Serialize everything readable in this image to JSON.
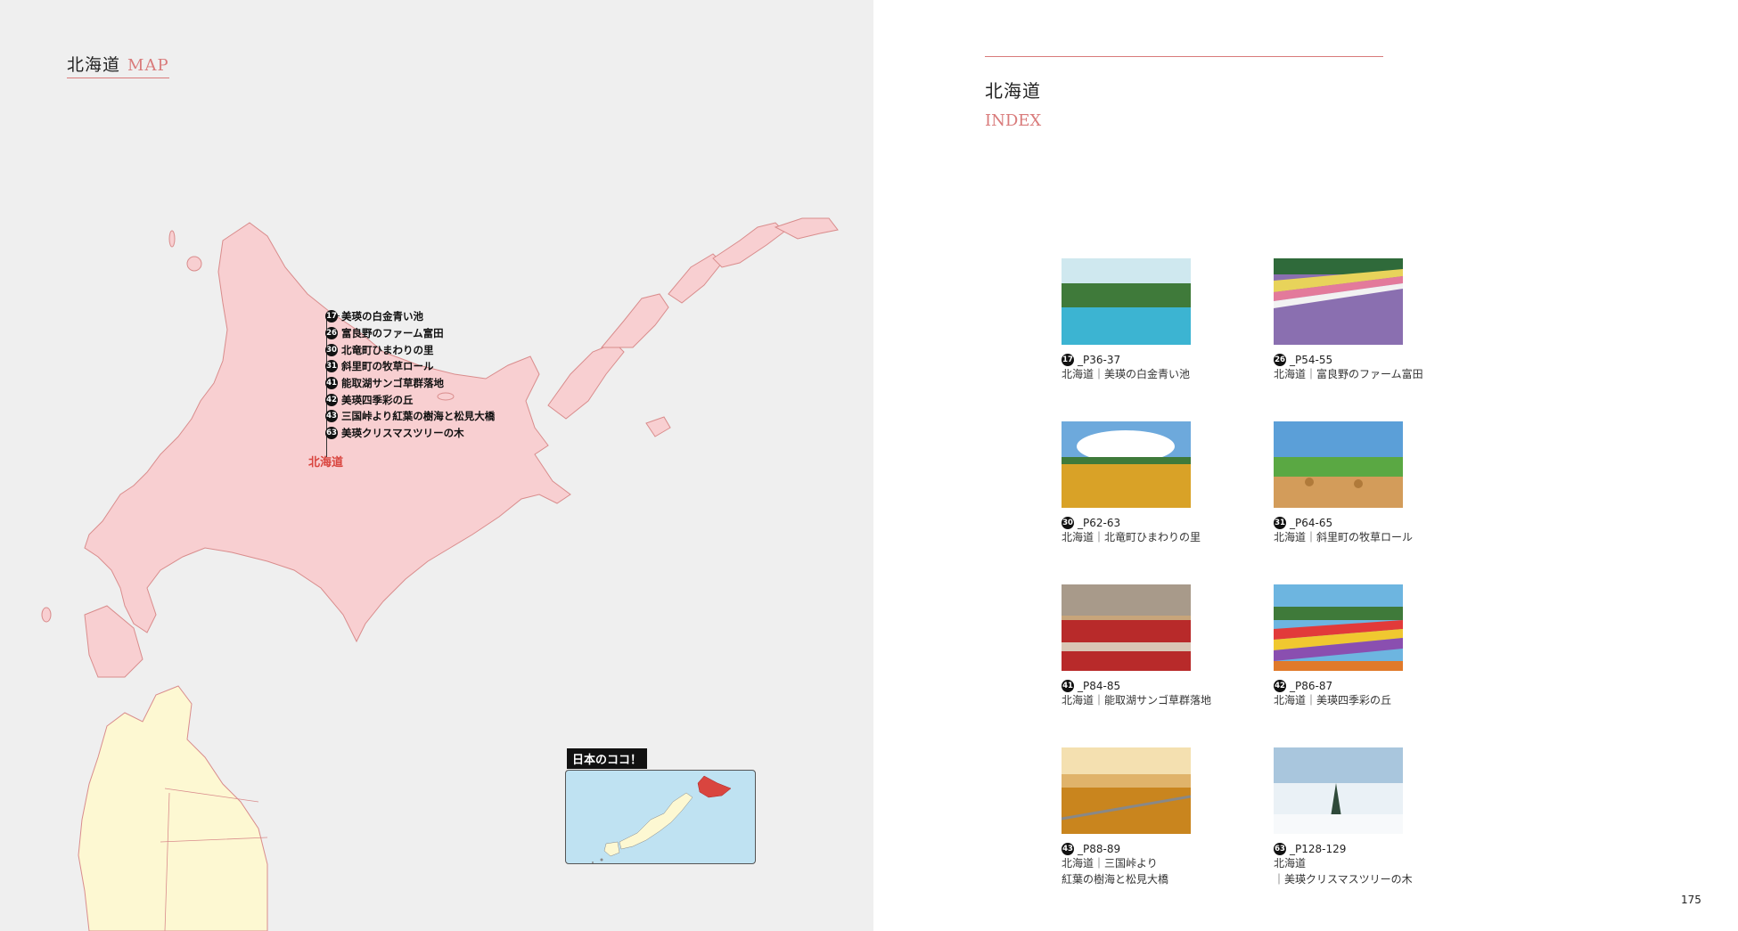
{
  "left": {
    "title": "北海道",
    "title_accent": "MAP",
    "pins": [
      {
        "num": "17",
        "label": "美瑛の白金青い池"
      },
      {
        "num": "26",
        "label": "富良野のファーム富田"
      },
      {
        "num": "30",
        "label": "北竜町ひまわりの里"
      },
      {
        "num": "31",
        "label": "斜里町の牧草ロール"
      },
      {
        "num": "41",
        "label": "能取湖サンゴ草群落地"
      },
      {
        "num": "42",
        "label": "美瑛四季彩の丘"
      },
      {
        "num": "43",
        "label": "三国峠より紅葉の樹海と松見大橋"
      },
      {
        "num": "63",
        "label": "美瑛クリスマスツリーの木"
      }
    ],
    "region_label": "北海道",
    "inset_label": "日本のココ！"
  },
  "right": {
    "title": "北海道",
    "subtitle": "INDEX",
    "items": [
      {
        "num": "17",
        "page": "_P36-37",
        "desc": "北海道｜美瑛の白金青い池",
        "thumb": "lake"
      },
      {
        "num": "26",
        "page": "_P54-55",
        "desc": "北海道｜富良野のファーム富田",
        "thumb": "lavender"
      },
      {
        "num": "30",
        "page": "_P62-63",
        "desc": "北海道｜北竜町ひまわりの里",
        "thumb": "sunflower"
      },
      {
        "num": "31",
        "page": "_P64-65",
        "desc": "北海道｜斜里町の牧草ロール",
        "thumb": "hay"
      },
      {
        "num": "41",
        "page": "_P84-85",
        "desc": "北海道｜能取湖サンゴ草群落地",
        "thumb": "coral"
      },
      {
        "num": "42",
        "page": "_P86-87",
        "desc": "北海道｜美瑛四季彩の丘",
        "thumb": "flowerhill"
      },
      {
        "num": "43",
        "page": "_P88-89",
        "desc": "北海道｜三国峠より\n紅葉の樹海と松見大橋",
        "thumb": "autumn"
      },
      {
        "num": "63",
        "page": "_P128-129",
        "desc": "北海道\n｜美瑛クリスマスツリーの木",
        "thumb": "snowtree"
      }
    ],
    "folio": "175"
  },
  "colors": {
    "accent": "#d97b7b",
    "hokkaido_fill": "#f8cfd1",
    "honshu_fill": "#fdf8d2",
    "sea": "#efefef",
    "pin_red": "#d9453f"
  }
}
